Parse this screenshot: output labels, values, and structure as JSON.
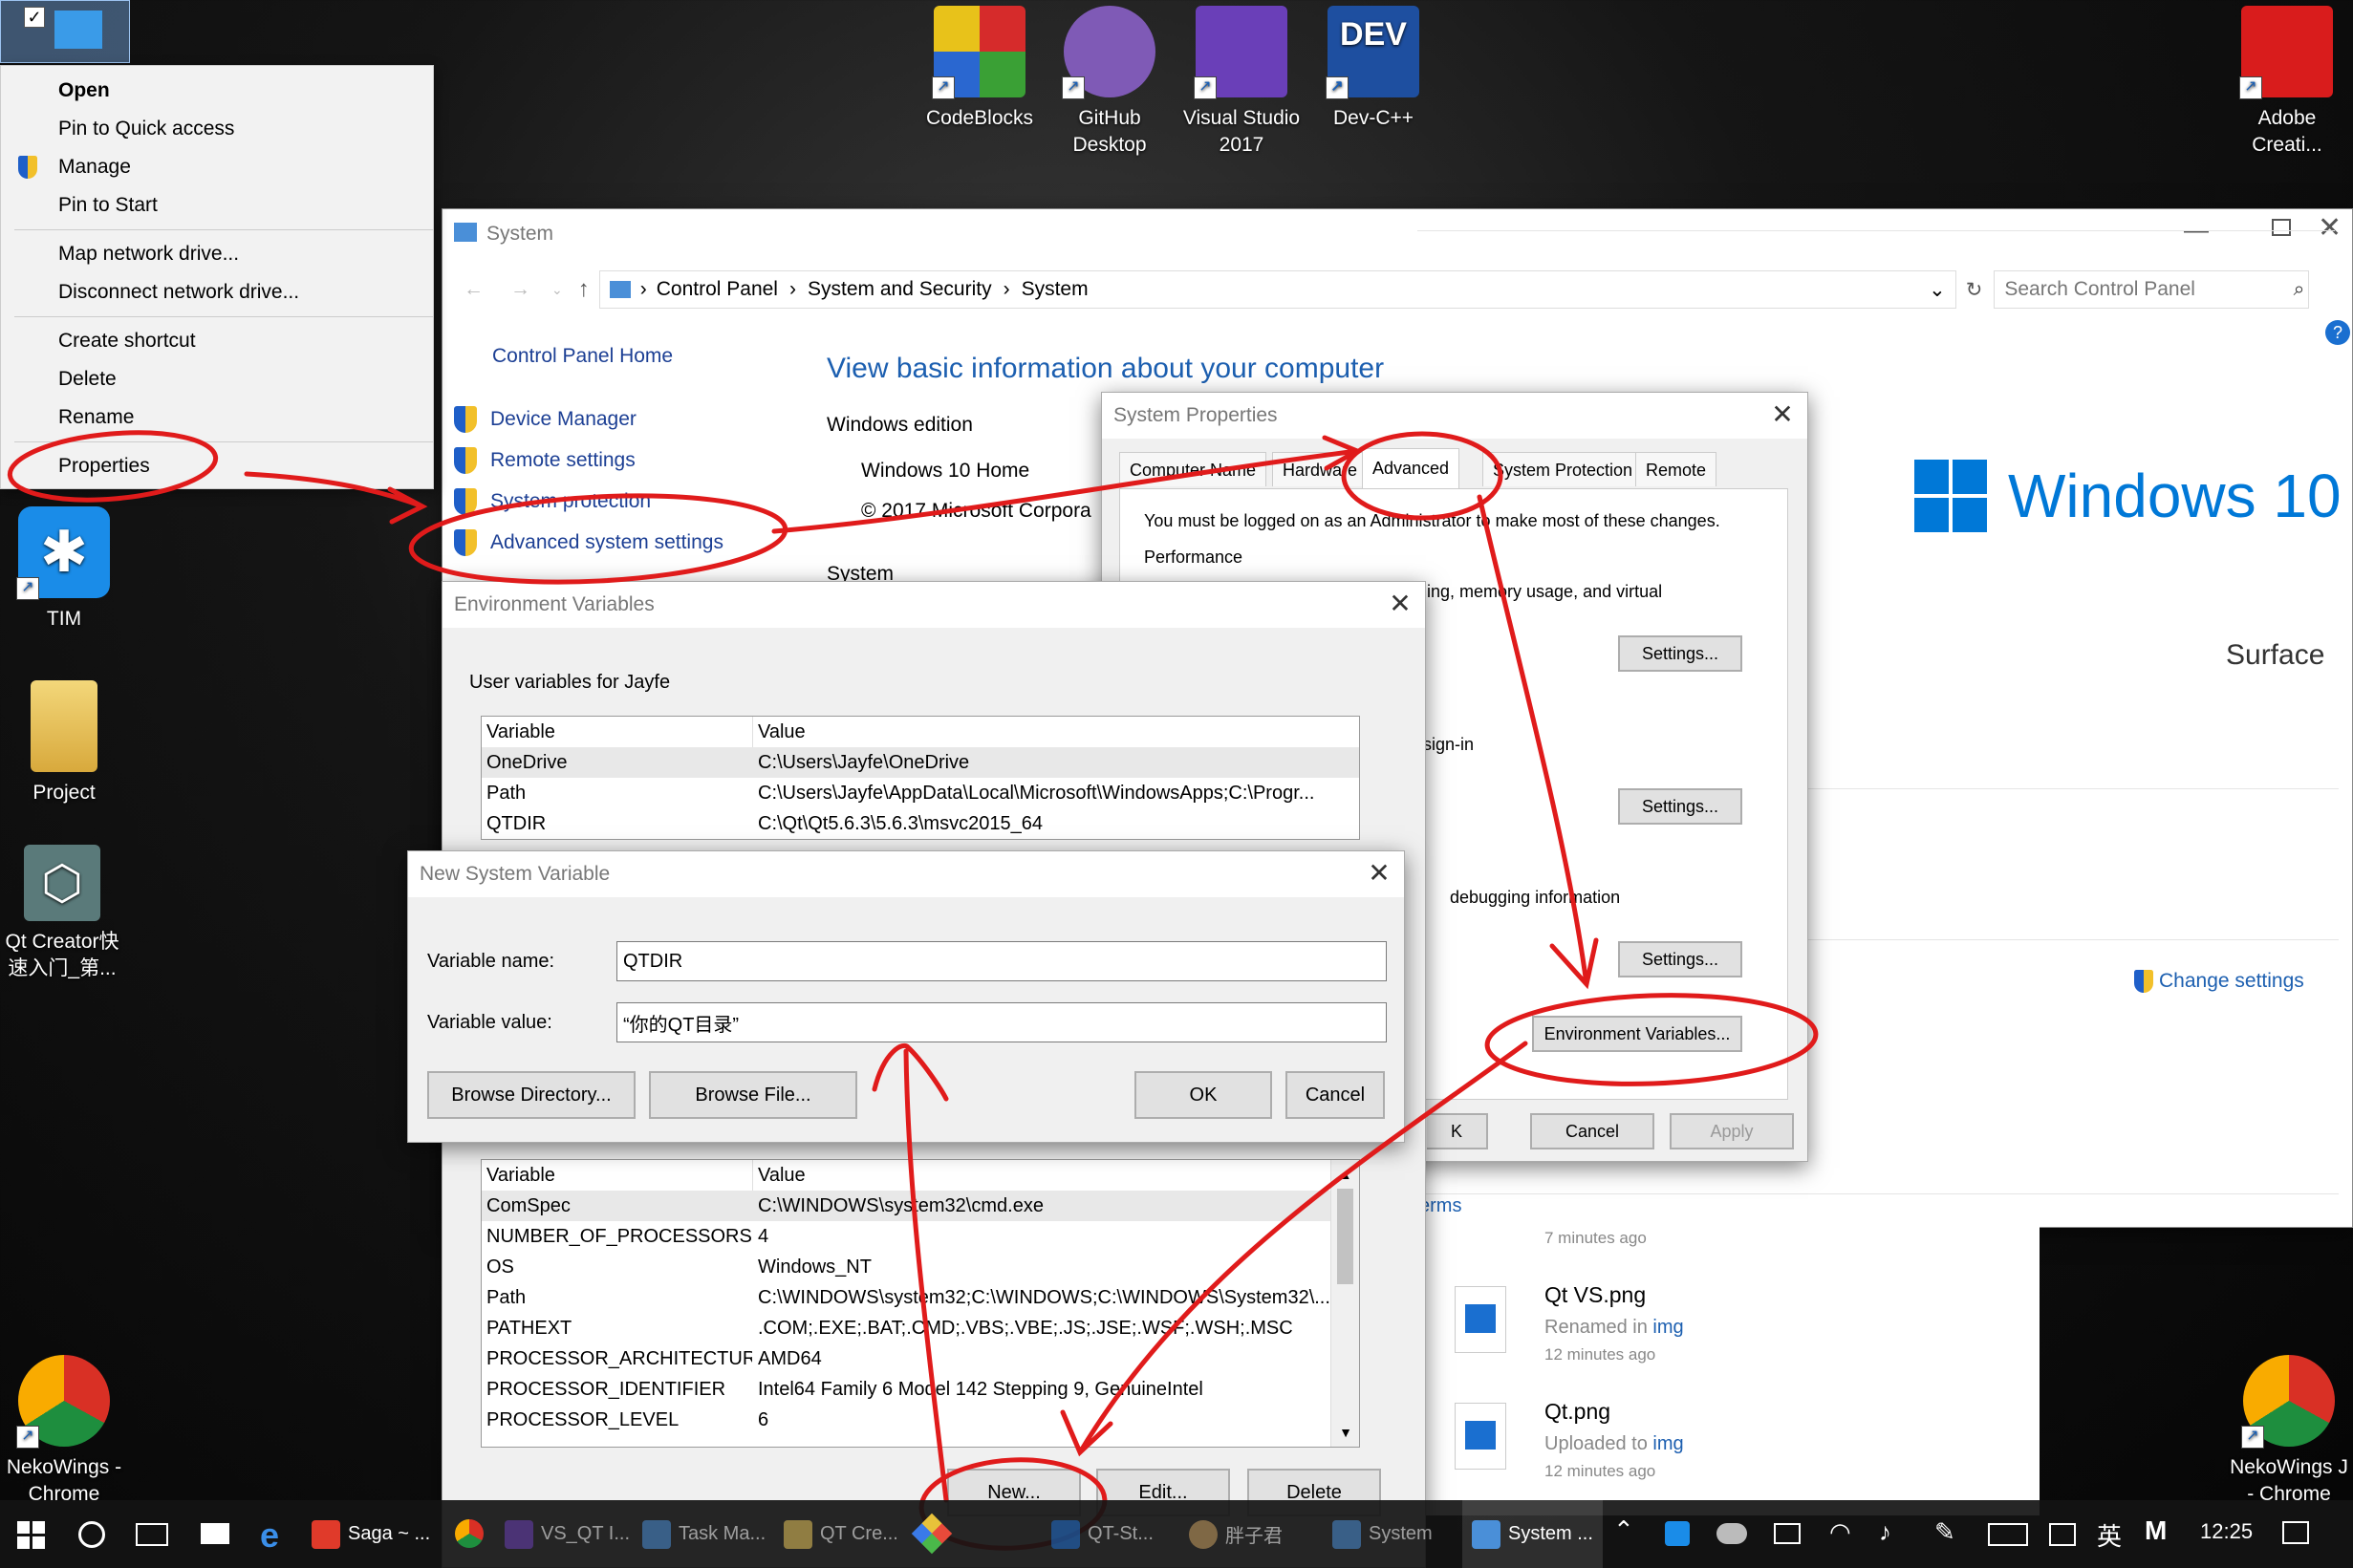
{
  "desktop": {
    "icons_top": [
      {
        "label": "CodeBlocks",
        "color": "#3a7d2f"
      },
      {
        "label": "GitHub\nDesktop",
        "color": "#7f5ab6"
      },
      {
        "label": "Visual Studio\n2017",
        "color": "#6a3fb8"
      },
      {
        "label": "Dev-C++",
        "color": "#1e4fa0"
      },
      {
        "label": "Adobe\nCreati...",
        "color": "#d91c1c"
      }
    ],
    "icons_left": [
      {
        "label": "TIM",
        "color": "#1a8ce8"
      },
      {
        "label": "Project",
        "color": "#e8c65a"
      },
      {
        "label": "Qt Creator快\n速入门_第...",
        "color": "#5a7a7a"
      },
      {
        "label": "NekoWings -\nChrome",
        "color": "#d93025"
      }
    ],
    "icon_right_bottom": {
      "label": "NekoWings J\n- Chrome"
    }
  },
  "context_menu": {
    "items": [
      "Open",
      "Pin to Quick access",
      "Manage",
      "Pin to Start",
      "Map network drive...",
      "Disconnect network drive...",
      "Create shortcut",
      "Delete",
      "Rename",
      "Properties"
    ]
  },
  "system_window": {
    "title": "System",
    "breadcrumb": [
      "Control Panel",
      "System and Security",
      "System"
    ],
    "search_placeholder": "Search Control Panel",
    "home_link": "Control Panel Home",
    "side_links": [
      "Device Manager",
      "Remote settings",
      "System protection",
      "Advanced system settings"
    ],
    "heading": "View basic information about your computer",
    "edition_label": "Windows edition",
    "edition": "Windows 10 Home",
    "copyright": "© 2017 Microsoft Corpora",
    "system_label": "System",
    "win10_logo": "Windows 10",
    "surface": "Surface",
    "change_settings": "Change settings",
    "terms_fragment": "erms"
  },
  "system_properties": {
    "title": "System Properties",
    "tabs": [
      "Computer Name",
      "Hardware",
      "Advanced",
      "System Protection",
      "Remote"
    ],
    "admin_note": "You must be logged on as an Administrator to make most of these changes.",
    "performance": "Performance",
    "perf_text": "ling, memory usage, and virtual",
    "signin_text": "sign-in",
    "debug_text": "debugging information",
    "settings_btn": "Settings...",
    "env_btn": "Environment Variables...",
    "ok_fragment": "K",
    "cancel": "Cancel",
    "apply": "Apply"
  },
  "env_vars": {
    "title": "Environment Variables",
    "user_section": "User variables for Jayfe",
    "col_variable": "Variable",
    "col_value": "Value",
    "user_rows": [
      {
        "name": "OneDrive",
        "value": "C:\\Users\\Jayfe\\OneDrive"
      },
      {
        "name": "Path",
        "value": "C:\\Users\\Jayfe\\AppData\\Local\\Microsoft\\WindowsApps;C:\\Progr..."
      },
      {
        "name": "QTDIR",
        "value": "C:\\Qt\\Qt5.6.3\\5.6.3\\msvc2015_64"
      }
    ],
    "system_rows": [
      {
        "name": "ComSpec",
        "value": "C:\\WINDOWS\\system32\\cmd.exe"
      },
      {
        "name": "NUMBER_OF_PROCESSORS",
        "value": "4"
      },
      {
        "name": "OS",
        "value": "Windows_NT"
      },
      {
        "name": "Path",
        "value": "C:\\WINDOWS\\system32;C:\\WINDOWS;C:\\WINDOWS\\System32\\..."
      },
      {
        "name": "PATHEXT",
        "value": ".COM;.EXE;.BAT;.CMD;.VBS;.VBE;.JS;.JSE;.WSF;.WSH;.MSC"
      },
      {
        "name": "PROCESSOR_ARCHITECTURE",
        "value": "AMD64"
      },
      {
        "name": "PROCESSOR_IDENTIFIER",
        "value": "Intel64 Family 6 Model 142 Stepping 9, GenuineIntel"
      },
      {
        "name": "PROCESSOR_LEVEL",
        "value": "6"
      }
    ],
    "new_btn": "New...",
    "edit_btn": "Edit...",
    "delete_btn": "Delete"
  },
  "new_var": {
    "title": "New System Variable",
    "name_label": "Variable name:",
    "name_value": "QTDIR",
    "value_label": "Variable value:",
    "value_value": "“你的QT目录”",
    "browse_dir": "Browse Directory...",
    "browse_file": "Browse File...",
    "ok": "OK",
    "cancel": "Cancel"
  },
  "activity": [
    {
      "name": "",
      "action": "",
      "time": "7 minutes ago"
    },
    {
      "name": "Qt VS.png",
      "action": "Renamed in ",
      "link": "img",
      "time": "12 minutes ago"
    },
    {
      "name": "Qt.png",
      "action": "Uploaded to ",
      "link": "img",
      "time": "12 minutes ago"
    }
  ],
  "taskbar": {
    "items": [
      {
        "label": "Saga ~ ...",
        "color": "#e03a2a"
      },
      {
        "label": "VS_QT I...",
        "color": "#6a3fb8"
      },
      {
        "label": "Task Ma...",
        "color": "#4a8fd8"
      },
      {
        "label": "QT Cre...",
        "color": "#e8c65a"
      },
      {
        "label": "QT-St...",
        "color": "#1e6fd0"
      },
      {
        "label": "胖子君",
        "color": "#caa060"
      },
      {
        "label": "System",
        "color": "#4a8fd8"
      },
      {
        "label": "System ...",
        "color": "#4a8fd8"
      }
    ],
    "ime": "英",
    "ime2": "M",
    "time": "12:25"
  },
  "colors": {
    "annotation": "#e01b1b",
    "link": "#1c3f94",
    "accent": "#0078d7"
  }
}
